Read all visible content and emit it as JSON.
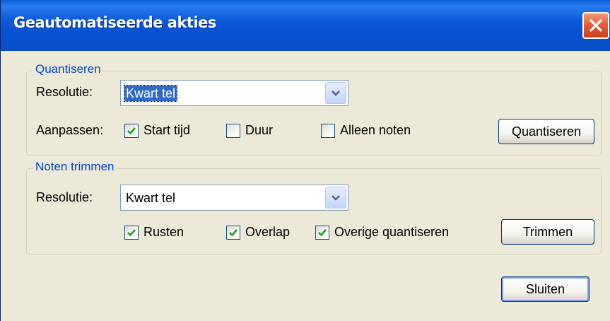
{
  "window": {
    "title": "Geautomatiseerde akties"
  },
  "quantize_group": {
    "legend": "Quantiseren",
    "resolution_label": "Resolutie:",
    "resolution_value": "Kwart tel",
    "adjust_label": "Aanpassen:",
    "checkboxes": [
      {
        "label": "Start tijd",
        "checked": true
      },
      {
        "label": "Duur",
        "checked": false
      },
      {
        "label": "Alleen noten",
        "checked": false
      }
    ],
    "button_label": "Quantiseren"
  },
  "trim_group": {
    "legend": "Noten trimmen",
    "resolution_label": "Resolutie:",
    "resolution_value": "Kwart tel",
    "checkboxes": [
      {
        "label": "Rusten",
        "checked": true
      },
      {
        "label": "Overlap",
        "checked": true
      },
      {
        "label": "Overige quantiseren",
        "checked": true
      }
    ],
    "button_label": "Trimmen"
  },
  "close_button_label": "Sluiten",
  "colors": {
    "titlebar": "#0a5fd8",
    "legend_text": "#0046d5",
    "checkmark": "#21a121",
    "dialog_background": "#ece9d8"
  },
  "icons": {
    "close": "close-icon",
    "dropdown": "chevron-down-icon",
    "check": "checkmark-icon"
  }
}
